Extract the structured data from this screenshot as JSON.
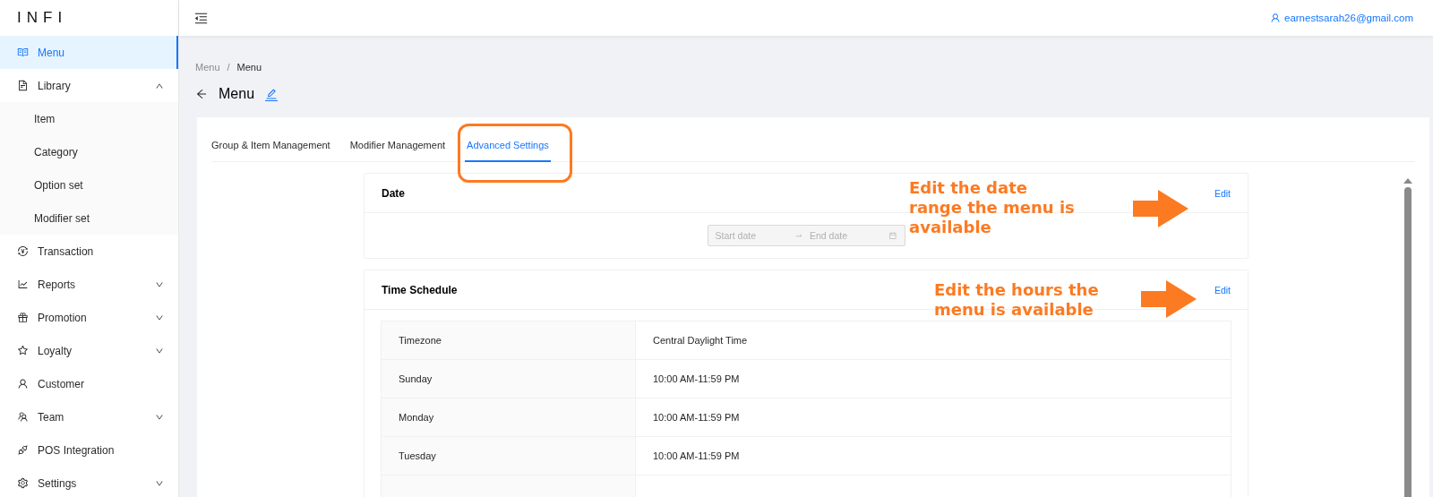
{
  "logo": "INFI",
  "sidebar": {
    "items": [
      {
        "label": "Menu",
        "selected": true
      },
      {
        "label": "Library",
        "selected": false,
        "expanded": true,
        "children": [
          {
            "label": "Item",
            "selected": false
          },
          {
            "label": "Category",
            "selected": false
          },
          {
            "label": "Option set",
            "selected": false
          },
          {
            "label": "Modifier set",
            "selected": false
          }
        ]
      },
      {
        "label": "Transaction",
        "selected": false
      },
      {
        "label": "Reports",
        "selected": false,
        "expanded": false
      },
      {
        "label": "Promotion",
        "selected": false,
        "expanded": false
      },
      {
        "label": "Loyalty",
        "selected": false,
        "expanded": false
      },
      {
        "label": "Customer",
        "selected": false
      },
      {
        "label": "Team",
        "selected": false,
        "expanded": false
      },
      {
        "label": "POS Integration",
        "selected": false
      },
      {
        "label": "Settings",
        "selected": false,
        "expanded": false
      }
    ]
  },
  "header": {
    "user_email": "earnestsarah26@gmail.com"
  },
  "breadcrumb": {
    "items": [
      "Menu",
      "Menu"
    ],
    "separator": "/"
  },
  "page_title": "Menu",
  "tabs": [
    {
      "label": "Group & Item Management",
      "selected": false
    },
    {
      "label": "Modifier Management",
      "selected": false
    },
    {
      "label": "Advanced Settings",
      "selected": true
    }
  ],
  "date_section": {
    "title": "Date",
    "edit_link": "Edit",
    "start_placeholder": "Start date",
    "end_placeholder": "End date",
    "disabled": true
  },
  "time_schedule": {
    "title": "Time Schedule",
    "edit_link": "Edit",
    "rows": [
      {
        "label": "Timezone",
        "value": "Central Daylight Time"
      },
      {
        "label": "Sunday",
        "value": "10:00 AM-11:59 PM"
      },
      {
        "label": "Monday",
        "value": "10:00 AM-11:59 PM"
      },
      {
        "label": "Tuesday",
        "value": "10:00 AM-11:59 PM"
      }
    ]
  },
  "annotations": [
    {
      "text": "Edit the date\nrange the menu is\navailable"
    },
    {
      "text": "Edit the hours the\nmenu is available"
    }
  ]
}
